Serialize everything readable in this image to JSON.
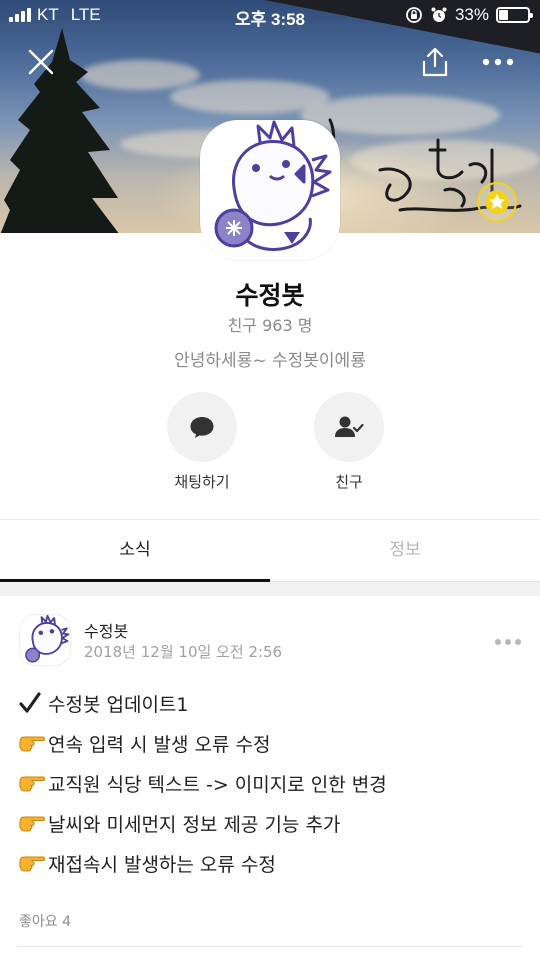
{
  "status_bar": {
    "carrier": "KT",
    "network": "LTE",
    "time": "오후 3:58",
    "battery_percent": "33%",
    "battery_level": 0.33
  },
  "header": {
    "close_icon": "close-icon",
    "share_icon": "share-icon",
    "more_icon": "more-horizontal-icon"
  },
  "profile": {
    "name": "수정봇",
    "friends_label": "친구 963 명",
    "status_message": "안녕하세룡~ 수정봇이에룡",
    "badge_icon": "star-icon",
    "badge_color": "#f2d21b"
  },
  "actions": [
    {
      "label": "채팅하기",
      "icon": "chat-bubble-icon"
    },
    {
      "label": "친구",
      "icon": "person-check-icon"
    }
  ],
  "tabs": [
    {
      "label": "소식",
      "active": true
    },
    {
      "label": "정보",
      "active": false
    }
  ],
  "post": {
    "author": "수정봇",
    "timestamp": "2018년 12월 10일 오전 2:56",
    "lines": [
      {
        "emoji": "✔",
        "text": "수정봇 업데이트1"
      },
      {
        "emoji": "👉",
        "text": "연속 입력 시  발생 오류 수정"
      },
      {
        "emoji": "👉",
        "text": "교직원 식당 텍스트 -> 이미지로 인한 변경"
      },
      {
        "emoji": "👉",
        "text": "날씨와 미세먼지 정보 제공 기능 추가"
      },
      {
        "emoji": "👉",
        "text": "재접속시 발생하는 오류 수정"
      }
    ],
    "likes": "좋아요 4"
  },
  "colors": {
    "accent_text": "#222222",
    "muted_text": "#8a8a8a",
    "character_purple": "#5a4fa8"
  }
}
